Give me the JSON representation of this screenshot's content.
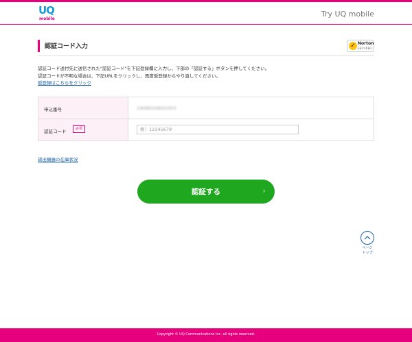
{
  "header": {
    "logo_uq": "UQ",
    "logo_mobile": "mobile",
    "title": "Try UQ mobile"
  },
  "page": {
    "title": "認証コード入力",
    "norton_label": "Norton",
    "norton_sub": "SECURED"
  },
  "description": {
    "line1": "認証コード送付先に送信された\"認証コード\"を下記登録欄に入力し、下部の「認証する」ボタンを押してください。",
    "line2": "認証コードが不明な場合は、下記URLをクリックし、再度仮登録からやり直してください。",
    "link": "仮登録はこちらをクリック"
  },
  "form": {
    "application_number_label": "申込番号",
    "application_number_value": "1908034850303",
    "code_label": "認証コード",
    "required_badge": "必須",
    "code_placeholder": "例）12345678",
    "code_value": ""
  },
  "stock_link": "貸出機器の在庫状況",
  "submit": {
    "label": "認証する",
    "arrow": "›"
  },
  "pagetop": {
    "line1": "ページ",
    "line2": "トップ"
  },
  "footer": {
    "copyright": "Copyright © UQ Communications Inc. all rights reserved."
  },
  "colors": {
    "brand_pink": "#e6007e",
    "brand_blue": "#1a9ad7",
    "button_green": "#1fa71f",
    "link_blue": "#1a5fa8"
  }
}
